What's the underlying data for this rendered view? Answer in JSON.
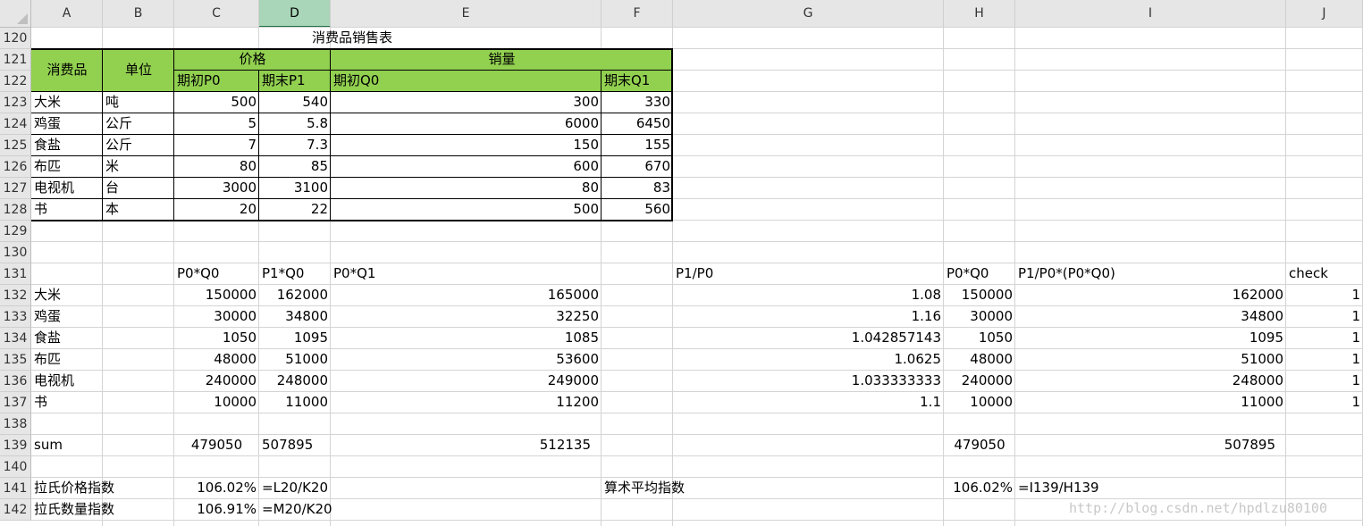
{
  "columns": [
    "A",
    "B",
    "C",
    "D",
    "E",
    "F",
    "G",
    "H",
    "I",
    "J"
  ],
  "selected_column": "D",
  "rows": [
    "120",
    "121",
    "122",
    "123",
    "124",
    "125",
    "126",
    "127",
    "128",
    "129",
    "130",
    "131",
    "132",
    "133",
    "134",
    "135",
    "136",
    "137",
    "138",
    "139",
    "140",
    "141",
    "142"
  ],
  "title": "消费品销售表",
  "header": {
    "consumer": "消费品",
    "unit": "单位",
    "price": "价格",
    "volume": "销量",
    "p0": "期初P0",
    "p1": "期末P1",
    "q0": "期初Q0",
    "q1": "期末Q1"
  },
  "table": [
    {
      "name": "大米",
      "unit": "吨",
      "p0": "500",
      "p1": "540",
      "q0": "300",
      "q1": "330"
    },
    {
      "name": "鸡蛋",
      "unit": "公斤",
      "p0": "5",
      "p1": "5.8",
      "q0": "6000",
      "q1": "6450"
    },
    {
      "name": "食盐",
      "unit": "公斤",
      "p0": "7",
      "p1": "7.3",
      "q0": "150",
      "q1": "155"
    },
    {
      "name": "布匹",
      "unit": "米",
      "p0": "80",
      "p1": "85",
      "q0": "600",
      "q1": "670"
    },
    {
      "name": "电视机",
      "unit": "台",
      "p0": "3000",
      "p1": "3100",
      "q0": "80",
      "q1": "83"
    },
    {
      "name": "书",
      "unit": "本",
      "p0": "20",
      "p1": "22",
      "q0": "500",
      "q1": "560"
    }
  ],
  "calc_header": {
    "p0q0": "P0*Q0",
    "p1q0": "P1*Q0",
    "p0q1": "P0*Q1",
    "p1_p0": "P1/P0",
    "h_p0q0": "P0*Q0",
    "weighted": "P1/P0*(P0*Q0)",
    "check": "check"
  },
  "calc": [
    {
      "name": "大米",
      "p0q0": "150000",
      "p1q0": "162000",
      "p0q1": "165000",
      "ratio": "1.08",
      "h": "150000",
      "i": "162000",
      "j": "1"
    },
    {
      "name": "鸡蛋",
      "p0q0": "30000",
      "p1q0": "34800",
      "p0q1": "32250",
      "ratio": "1.16",
      "h": "30000",
      "i": "34800",
      "j": "1"
    },
    {
      "name": "食盐",
      "p0q0": "1050",
      "p1q0": "1095",
      "p0q1": "1085",
      "ratio": "1.042857143",
      "h": "1050",
      "i": "1095",
      "j": "1"
    },
    {
      "name": "布匹",
      "p0q0": "48000",
      "p1q0": "51000",
      "p0q1": "53600",
      "ratio": "1.0625",
      "h": "48000",
      "i": "51000",
      "j": "1"
    },
    {
      "name": "电视机",
      "p0q0": "240000",
      "p1q0": "248000",
      "p0q1": "249000",
      "ratio": "1.033333333",
      "h": "240000",
      "i": "248000",
      "j": "1"
    },
    {
      "name": "书",
      "p0q0": "10000",
      "p1q0": "11000",
      "p0q1": "11200",
      "ratio": "1.1",
      "h": "10000",
      "i": "11000",
      "j": "1"
    }
  ],
  "sum": {
    "label": "sum",
    "c": "479050",
    "d": "507895",
    "e": "512135",
    "h": "479050",
    "i": "507895"
  },
  "laspeyres_price": {
    "label": "拉氏价格指数",
    "value": "106.02%",
    "formula": "=L20/K20"
  },
  "laspeyres_qty": {
    "label": "拉氏数量指数",
    "value": "106.91%",
    "formula": "=M20/K20"
  },
  "arith_index": {
    "label": "算术平均指数",
    "value": "106.02%",
    "formula": "=I139/H139"
  },
  "watermark": "http://blog.csdn.net/hpdlzu80100"
}
